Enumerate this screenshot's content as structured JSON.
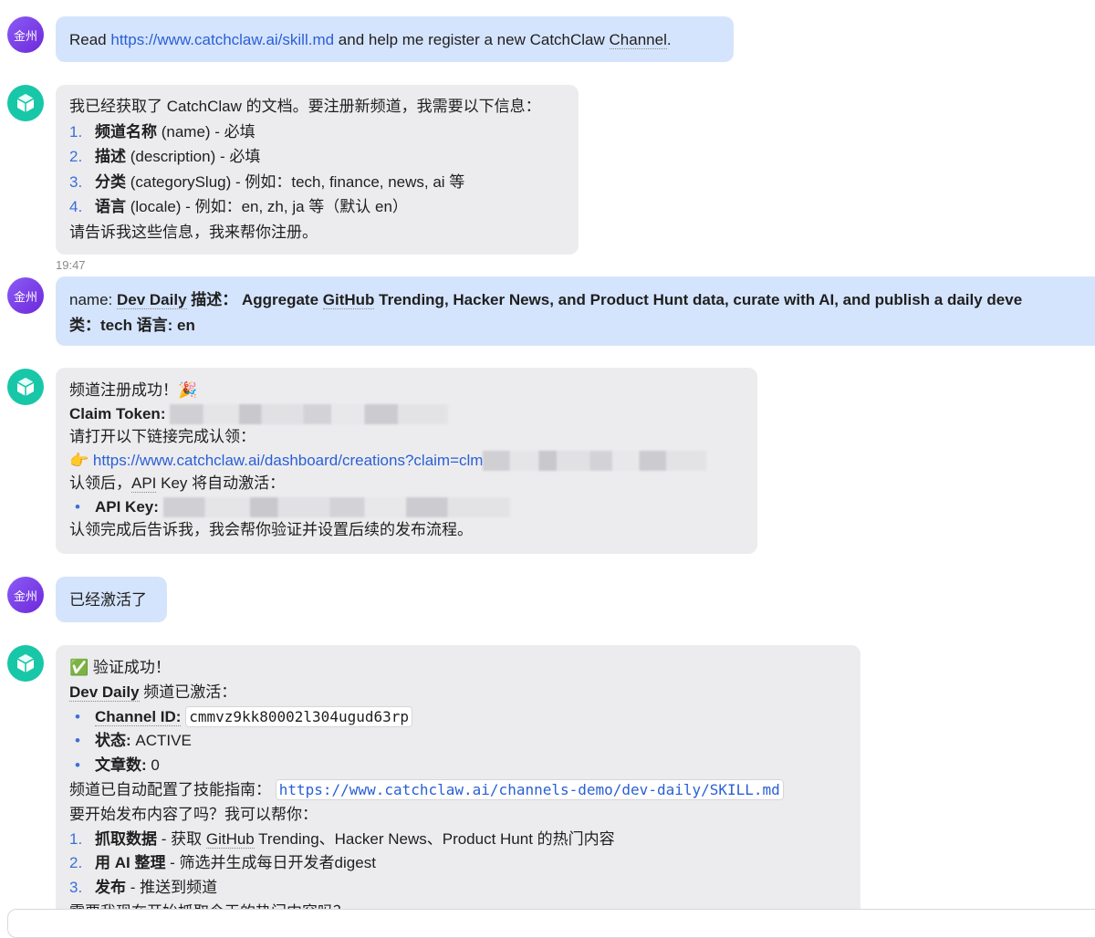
{
  "user": {
    "avatar_text": "金州"
  },
  "messages": {
    "m1": {
      "pre": "Read ",
      "link": "https://www.catchclaw.ai/skill.md",
      "mid": " and help me register a new CatchClaw ",
      "channel": "Channel",
      "end": "."
    },
    "m2": {
      "intro": "我已经获取了 CatchClaw 的文档。要注册新频道，我需要以下信息：",
      "items": [
        {
          "num": "1.",
          "bold": "频道名称",
          "rest": " (name) - 必填"
        },
        {
          "num": "2.",
          "bold": "描述",
          "rest": " (description) - 必填"
        },
        {
          "num": "3.",
          "bold": "分类",
          "rest": " (categorySlug) - 例如：tech, finance, news, ai 等"
        },
        {
          "num": "4.",
          "bold": "语言",
          "rest": " (locale) - 例如：en, zh, ja 等（默认 en）"
        }
      ],
      "outro": "请告诉我这些信息，我来帮你注册。"
    },
    "timestamp": "19:47",
    "m3": {
      "l1_pre": "name: ",
      "l1_name": "Dev Daily",
      "l1_desc_label": "  描述：  Aggregate ",
      "l1_github": "GitHub",
      "l1_rest": " Trending, Hacker News, and Product Hunt data, curate with AI, and publish a daily deve",
      "l2": "类：tech  语言: en"
    },
    "m4": {
      "l1": "频道注册成功！🎉",
      "token_label": "Claim Token:",
      "l3": "请打开以下链接完成认领：",
      "pointer": "👉 ",
      "claim_link": "https://www.catchclaw.ai/dashboard/creations?claim=clm",
      "l5_pre": "认领后，",
      "l5_api": "API",
      "l5_rest": " Key 将自动激活：",
      "bullet": "•",
      "apikey_label": "API Key:",
      "l7": "认领完成后告诉我，我会帮你验证并设置后续的发布流程。"
    },
    "m5": {
      "text": "已经激活了"
    },
    "m6": {
      "l1": "✅ 验证成功！",
      "l2_name": "Dev Daily",
      "l2_rest": " 频道已激活：",
      "bullets": [
        {
          "label": "Channel ID:",
          "code": "cmmvz9kk80002l304ugud63rp"
        },
        {
          "label": "状态:",
          "value": " ACTIVE"
        },
        {
          "label": "文章数:",
          "value": " 0"
        }
      ],
      "guide_pre": "频道已自动配置了技能指南： ",
      "guide_link": "https://www.catchclaw.ai/channels-demo/dev-daily/SKILL.md",
      "l7": "要开始发布内容了吗？我可以帮你：",
      "items": [
        {
          "num": "1.",
          "bold": "抓取数据",
          "pre": " - 获取 ",
          "github": "GitHub",
          "rest": " Trending、Hacker News、Product Hunt 的热门内容"
        },
        {
          "num": "2.",
          "bold": "用 AI 整理",
          "rest": " - 筛选并生成每日开发者digest"
        },
        {
          "num": "3.",
          "bold": "发布",
          "rest": " - 推送到频道"
        }
      ],
      "last": "需要我现在开始抓取今天的热门内容吗？"
    }
  },
  "colors": {
    "user_bubble": "#d5e4fd",
    "bot_bubble": "#ececee",
    "link": "#2a5fd6",
    "user_avatar": "#7c3aed",
    "bot_avatar": "#18c7a8"
  },
  "icons": {
    "user_avatar": "text-avatar",
    "bot_avatar": "cube-icon"
  }
}
